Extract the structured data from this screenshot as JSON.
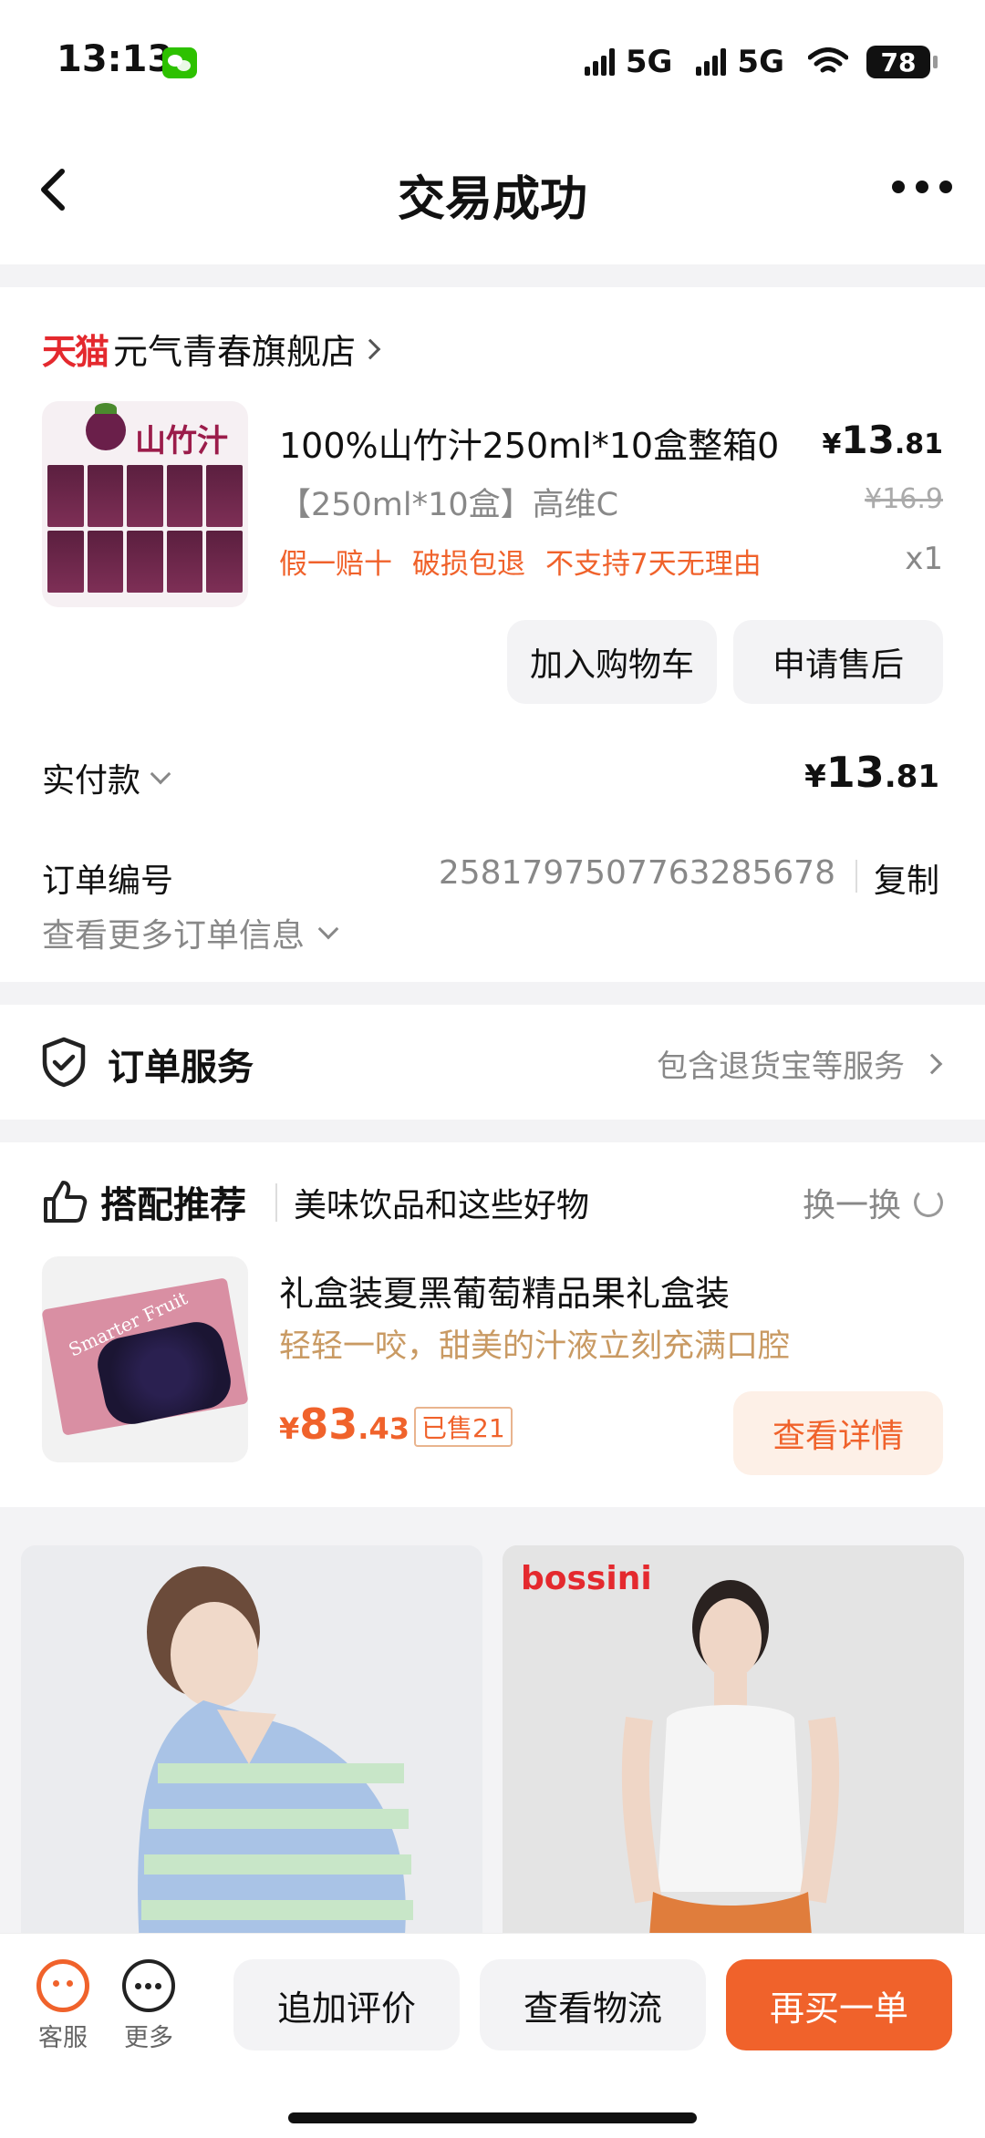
{
  "status_bar": {
    "time": "13:13",
    "network1": "5G",
    "network2": "5G",
    "battery": "78"
  },
  "nav": {
    "title": "交易成功",
    "back_icon": "chevron-left-icon",
    "more_icon": "more-dots-icon"
  },
  "order": {
    "platform": "天猫",
    "store_name": "元气青春旗舰店",
    "product": {
      "image_text": "山竹汁",
      "title": "100%山竹汁250ml*10盒整箱0",
      "spec": "【250ml*10盒】高维C",
      "tags": [
        "假一赔十",
        "破损包退",
        "不支持7天无理由"
      ],
      "price_symbol": "¥",
      "price_int": "13",
      "price_dec": ".81",
      "original_price": "¥16.9",
      "quantity": "x1"
    },
    "buttons": {
      "add_to_cart": "加入购物车",
      "after_sales": "申请售后"
    },
    "paid": {
      "label": "实付款",
      "symbol": "¥",
      "int": "13",
      "dec": ".81"
    },
    "order_no": {
      "label": "订单编号",
      "value": "2581797507763285678",
      "copy": "复制"
    },
    "more_info": "查看更多订单信息"
  },
  "service": {
    "title": "订单服务",
    "detail": "包含退货宝等服务"
  },
  "recommend": {
    "title": "搭配推荐",
    "subtitle": "美味饮品和这些好物",
    "swap": "换一换",
    "item": {
      "image_text": "Smarter Fruit",
      "title": "礼盒装夏黑葡萄精品果礼盒装",
      "desc": "轻轻一咬，甜美的汁液立刻充满口腔",
      "price_symbol": "¥",
      "price_int": "83",
      "price_dec": ".43",
      "sold": "已售21",
      "detail_button": "查看详情"
    }
  },
  "feed": {
    "right_brand": "bossini"
  },
  "bottom_bar": {
    "customer_service": "客服",
    "more": "更多",
    "add_review": "追加评价",
    "logistics": "查看物流",
    "rebuy": "再买一单"
  },
  "colors": {
    "accent": "#f0622b",
    "tmall_red": "#e4292e",
    "muted": "#888888",
    "background": "#f3f3f5"
  }
}
